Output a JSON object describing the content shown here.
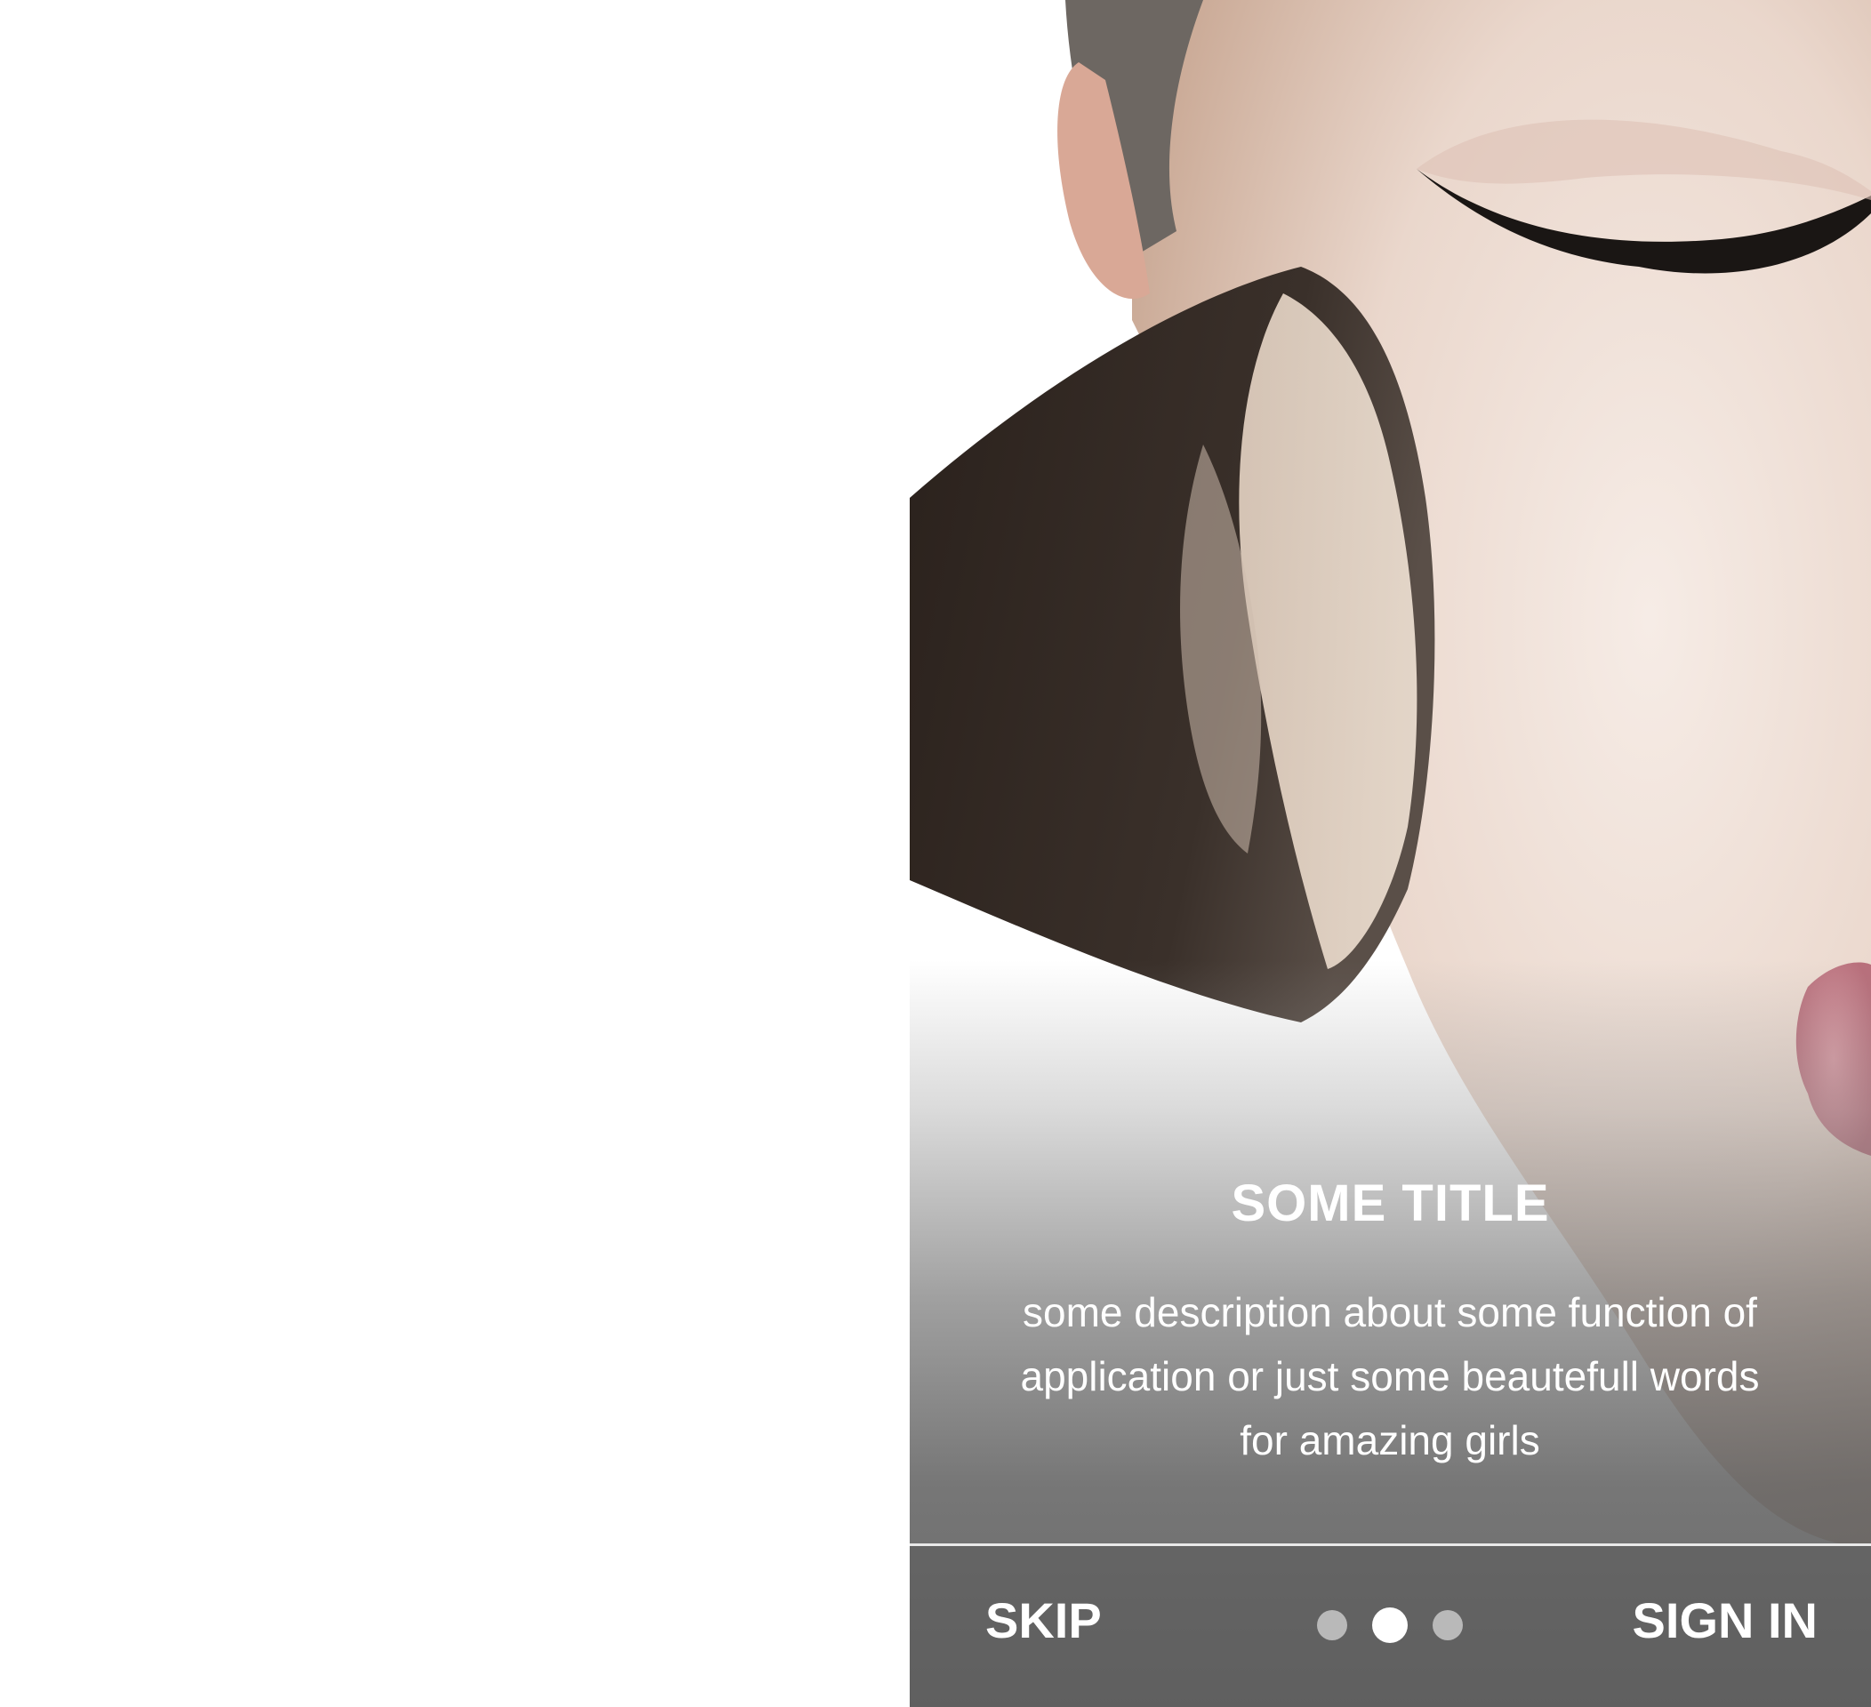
{
  "onboarding": {
    "title": "SOME TITLE",
    "description": "some description about some function of application or just some beautefull words for amazing girls",
    "skip_label": "SKIP",
    "signin_label": "SIGN IN",
    "pager": {
      "total": 3,
      "active_index": 1
    }
  },
  "colors": {
    "text": "#ffffff",
    "dot_inactive": "#b9b9b9",
    "dot_active": "#ffffff",
    "divider": "#e9e9e9"
  }
}
